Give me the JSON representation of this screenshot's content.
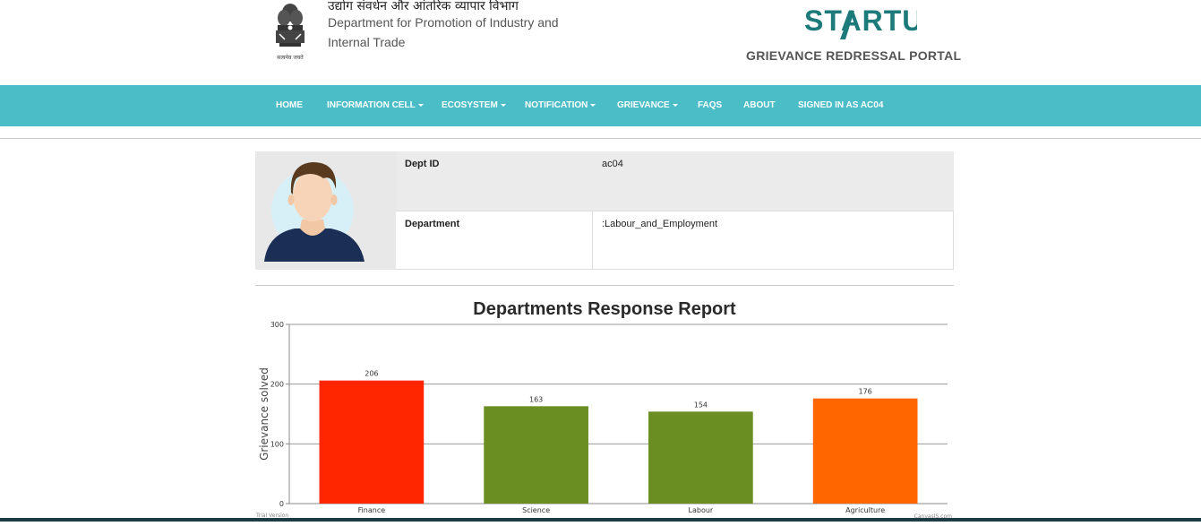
{
  "header": {
    "org_hindi": "उद्योग संवर्धन और आंतरिक व्यापार विभाग",
    "org_english": "Department for Promotion of Industry and Internal Trade",
    "emblem_motto": "सत्यमेव जयते",
    "logo_text": "STARTUP",
    "portal_name": "GRIEVANCE REDRESSAL PORTAL"
  },
  "nav": {
    "items": [
      {
        "label": "HOME",
        "caret": false
      },
      {
        "label": "INFORMATION CELL",
        "caret": true
      },
      {
        "label": "ECOSYSTEM",
        "caret": true
      },
      {
        "label": "NOTIFICATION",
        "caret": true
      },
      {
        "label": "GRIEVANCE",
        "caret": true
      },
      {
        "label": "FAQS",
        "caret": false
      },
      {
        "label": "ABOUT",
        "caret": false
      },
      {
        "label": "SIGNED IN AS AC04",
        "caret": false
      }
    ]
  },
  "profile": {
    "dept_id_label": "Dept ID",
    "dept_id_value": "ac04",
    "department_label": "Department",
    "department_value": ":Labour_and_Employment"
  },
  "colors": {
    "navbar": "#4bbdc7",
    "logo": "#1c7a7a",
    "finance": "#ff2600",
    "science": "#6b8e23",
    "labour": "#6b8e23",
    "agriculture": "#ff6600"
  },
  "chart_data": {
    "type": "bar",
    "title": "Departments Response Report",
    "ylabel": "Grievance solved",
    "xlabel": "",
    "categories": [
      "Finance",
      "Science",
      "Labour",
      "Agriculture"
    ],
    "values": [
      206,
      163,
      154,
      176
    ],
    "bar_colors": [
      "#ff2600",
      "#6b8e23",
      "#6b8e23",
      "#ff6600"
    ],
    "ylim": [
      0,
      300
    ],
    "yticks": [
      0,
      100,
      200,
      300
    ],
    "grid": true,
    "watermark_left": "Trial Version",
    "watermark_right": "CanvasJS.com"
  }
}
